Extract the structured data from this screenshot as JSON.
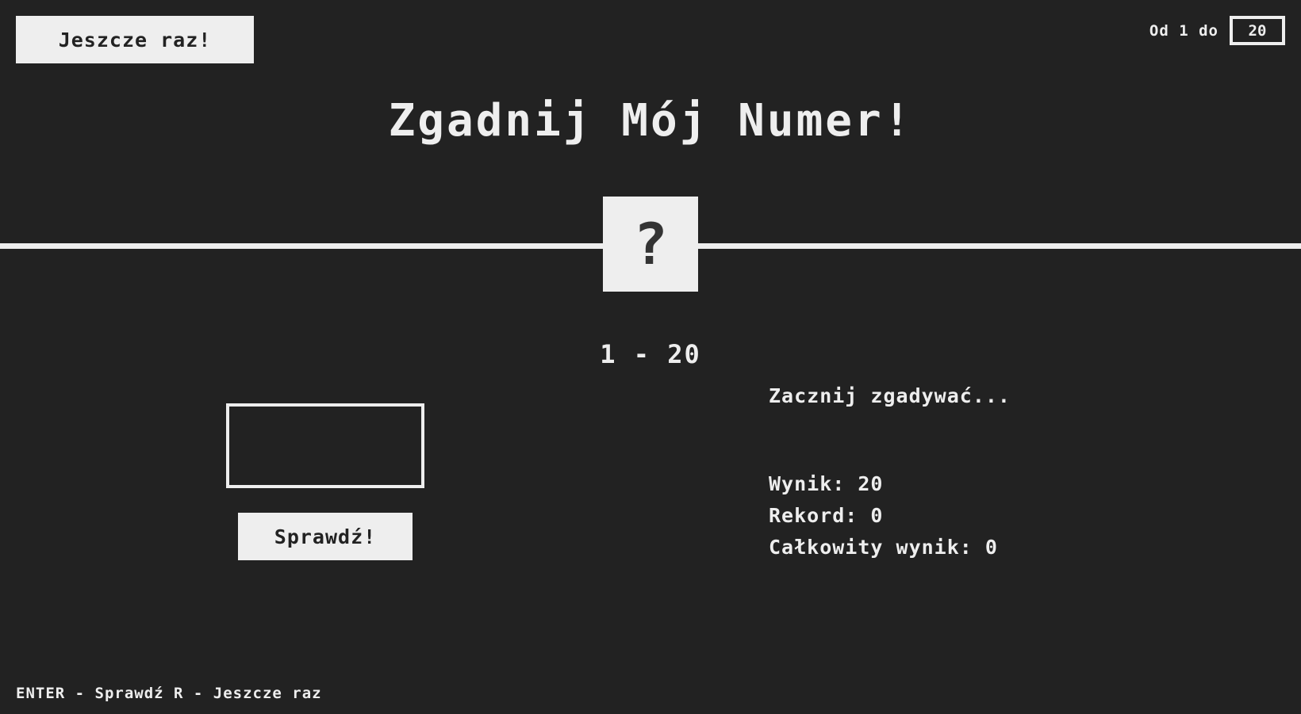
{
  "header": {
    "again_label": "Jeszcze raz!",
    "range_label": "Od 1 do",
    "range_max": "20"
  },
  "title": "Zgadnij Mój Numer!",
  "secret": {
    "symbol": "?"
  },
  "range_display": "1 - 20",
  "guess": {
    "value": "",
    "check_label": "Sprawdź!"
  },
  "status": {
    "message": "Zacznij zgadywać...",
    "score_label": "Wynik:",
    "score_value": "20",
    "highscore_label": "Rekord:",
    "highscore_value": "0",
    "total_label": "Całkowity wynik:",
    "total_value": "0"
  },
  "footer": {
    "hint": "ENTER - Sprawdź R - Jeszcze raz"
  },
  "colors": {
    "background": "#222222",
    "foreground": "#eeeeee"
  }
}
